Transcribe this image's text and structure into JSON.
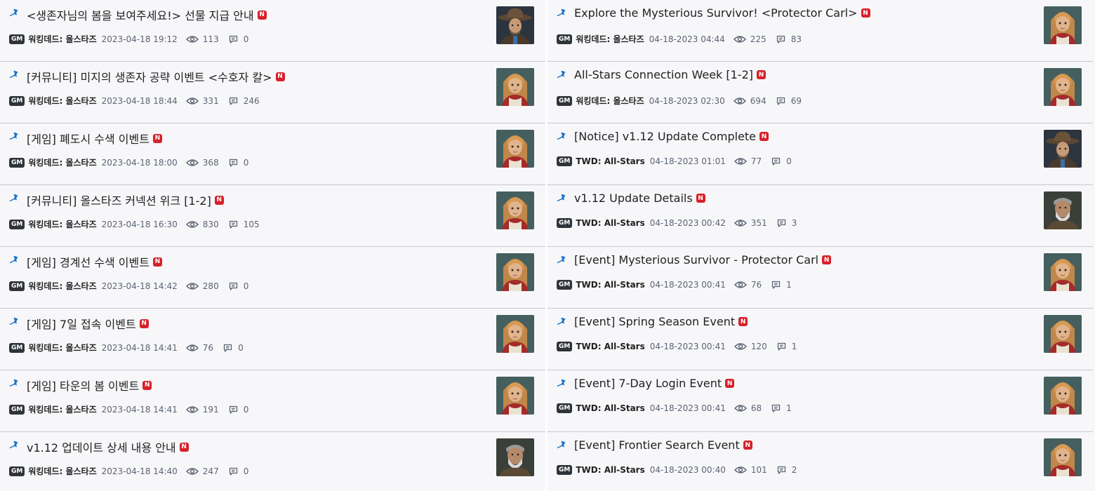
{
  "colors": {
    "pin": "#1a73c8",
    "new_badge": "#d8202a",
    "gm_badge": "#2f343a"
  },
  "left": [
    {
      "title": "<생존자님의 봄을 보여주세요!> 선물 지급 안내",
      "badge": "GM",
      "author": "워킹데드: 올스타즈",
      "date": "2023-04-18 19:12",
      "views": "113",
      "comments": "0",
      "thumb": "cowboy"
    },
    {
      "title": "[커뮤니티] 미지의 생존자 공략 이벤트 <수호자 칼>",
      "badge": "GM",
      "author": "워킹데드: 올스타즈",
      "date": "2023-04-18 18:44",
      "views": "331",
      "comments": "246",
      "thumb": "girl"
    },
    {
      "title": "[게임] 폐도시 수색 이벤트",
      "badge": "GM",
      "author": "워킹데드: 올스타즈",
      "date": "2023-04-18 18:00",
      "views": "368",
      "comments": "0",
      "thumb": "girl"
    },
    {
      "title": "[커뮤니티] 올스타즈 커넥션 위크 [1-2]",
      "badge": "GM",
      "author": "워킹데드: 올스타즈",
      "date": "2023-04-18 16:30",
      "views": "830",
      "comments": "105",
      "thumb": "girl"
    },
    {
      "title": "[게임] 경계선 수색 이벤트",
      "badge": "GM",
      "author": "워킹데드: 올스타즈",
      "date": "2023-04-18 14:42",
      "views": "280",
      "comments": "0",
      "thumb": "girl"
    },
    {
      "title": "[게임] 7일 접속 이벤트",
      "badge": "GM",
      "author": "워킹데드: 올스타즈",
      "date": "2023-04-18 14:41",
      "views": "76",
      "comments": "0",
      "thumb": "girl"
    },
    {
      "title": "[게임] 타운의 봄 이벤트",
      "badge": "GM",
      "author": "워킹데드: 올스타즈",
      "date": "2023-04-18 14:41",
      "views": "191",
      "comments": "0",
      "thumb": "girl"
    },
    {
      "title": "v1.12 업데이트 상세 내용 안내",
      "badge": "GM",
      "author": "워킹데드: 올스타즈",
      "date": "2023-04-18 14:40",
      "views": "247",
      "comments": "0",
      "thumb": "old"
    }
  ],
  "right": [
    {
      "title": "Explore the Mysterious Survivor! <Protector Carl>",
      "badge": "GM",
      "author": "워킹데드: 올스타즈",
      "date": "04-18-2023 04:44",
      "views": "225",
      "comments": "83",
      "thumb": "girl"
    },
    {
      "title": "All-Stars Connection Week [1-2]",
      "badge": "GM",
      "author": "워킹데드: 올스타즈",
      "date": "04-18-2023 02:30",
      "views": "694",
      "comments": "69",
      "thumb": "girl"
    },
    {
      "title": "[Notice] v1.12 Update Complete",
      "badge": "GM",
      "author": "TWD: All-Stars",
      "date": "04-18-2023 01:01",
      "views": "77",
      "comments": "0",
      "thumb": "cowboy"
    },
    {
      "title": "v1.12 Update Details",
      "badge": "GM",
      "author": "TWD: All-Stars",
      "date": "04-18-2023 00:42",
      "views": "351",
      "comments": "3",
      "thumb": "old"
    },
    {
      "title": "[Event] Mysterious Survivor - Protector Carl",
      "badge": "GM",
      "author": "TWD: All-Stars",
      "date": "04-18-2023 00:41",
      "views": "76",
      "comments": "1",
      "thumb": "girl"
    },
    {
      "title": "[Event] Spring Season Event",
      "badge": "GM",
      "author": "TWD: All-Stars",
      "date": "04-18-2023 00:41",
      "views": "120",
      "comments": "1",
      "thumb": "girl"
    },
    {
      "title": "[Event] 7-Day Login Event",
      "badge": "GM",
      "author": "TWD: All-Stars",
      "date": "04-18-2023 00:41",
      "views": "68",
      "comments": "1",
      "thumb": "girl"
    },
    {
      "title": "[Event] Frontier Search Event",
      "badge": "GM",
      "author": "TWD: All-Stars",
      "date": "04-18-2023 00:40",
      "views": "101",
      "comments": "2",
      "thumb": "girl"
    }
  ]
}
